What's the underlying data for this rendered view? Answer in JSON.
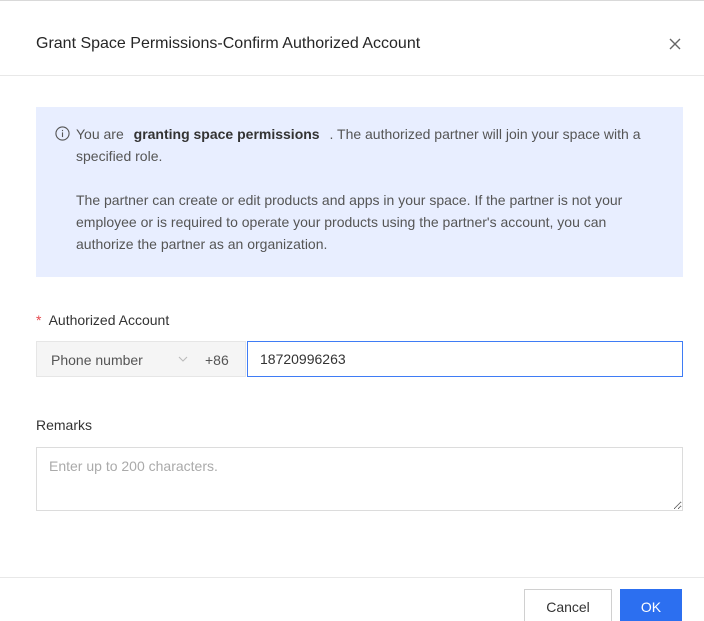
{
  "dialog": {
    "title": "Grant Space Permissions-Confirm Authorized Account",
    "close_icon": "close-icon"
  },
  "notice": {
    "icon": "info-icon",
    "p1_prefix": "You are",
    "p1_bold": "granting space permissions",
    "p1_suffix": ". The authorized partner will join your space with a specified role.",
    "p2": "The partner can create or edit products and apps in your space. If the partner is not your employee or is required to operate your products using the partner's account, you can authorize the partner as an organization."
  },
  "account": {
    "required_mark": "*",
    "label": "Authorized Account",
    "type_selected": "Phone number",
    "country_code": "+86",
    "value": "18720996263"
  },
  "remarks": {
    "label": "Remarks",
    "placeholder": "Enter up to 200 characters.",
    "value": ""
  },
  "footer": {
    "cancel_label": "Cancel",
    "ok_label": "OK"
  },
  "colors": {
    "primary": "#2c6ff0",
    "notice_bg": "#e8eeff",
    "required": "#e5484d"
  }
}
